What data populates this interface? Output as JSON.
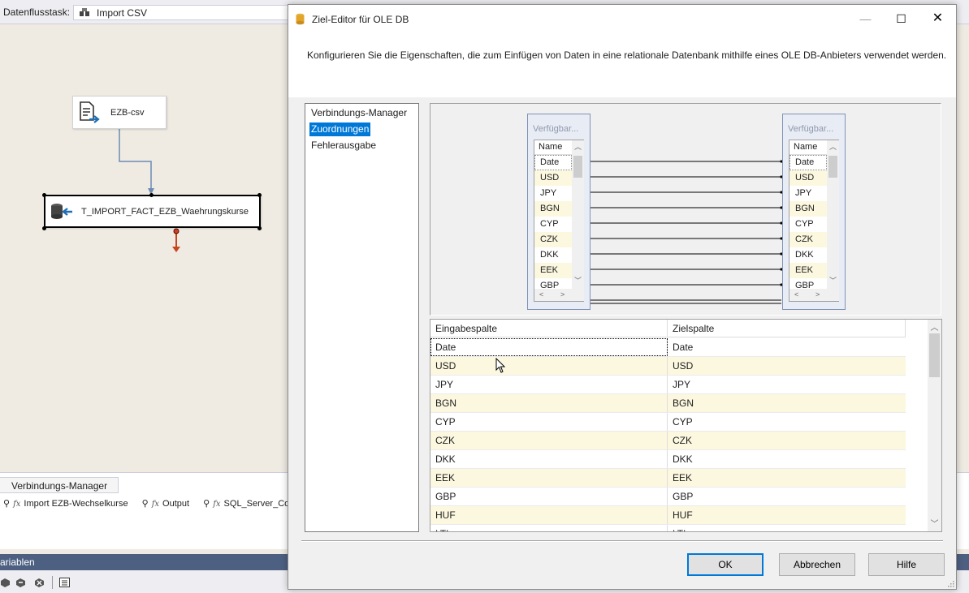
{
  "designer": {
    "task_label": "Datenflusstask:",
    "task_value": "Import CSV",
    "source_component": "EZB-csv",
    "destination_component": "T_IMPORT_FACT_EZB_Waehrungskurse",
    "connection_tab": "Verbindungs-Manager",
    "connections": [
      "Import EZB-Wechselkurse",
      "Output",
      "SQL_Server_Con"
    ],
    "fx_symbol": "fx",
    "variables_tab": "ariablen"
  },
  "dialog": {
    "title": "Ziel-Editor für OLE DB",
    "description": "Konfigurieren Sie die Eigenschaften, die zum Einfügen von Daten in eine relationale Datenbank mithilfe eines OLE DB-Anbieters verwendet werden.",
    "nav": [
      {
        "label": "Verbindungs-Manager",
        "selected": false
      },
      {
        "label": "Zuordnungen",
        "selected": true
      },
      {
        "label": "Fehlerausgabe",
        "selected": false
      }
    ],
    "input_box": {
      "header": "Verfügbar...",
      "column_header": "Name",
      "columns": [
        "Date",
        "USD",
        "JPY",
        "BGN",
        "CYP",
        "CZK",
        "DKK",
        "EEK",
        "GBP"
      ]
    },
    "dest_box": {
      "header": "Verfügbar...",
      "column_header": "Name",
      "columns": [
        "Date",
        "USD",
        "JPY",
        "BGN",
        "CYP",
        "CZK",
        "DKK",
        "EEK",
        "GBP"
      ]
    },
    "grid": {
      "headers": [
        "Eingabespalte",
        "Zielspalte"
      ],
      "rows": [
        [
          "Date",
          "Date"
        ],
        [
          "USD",
          "USD"
        ],
        [
          "JPY",
          "JPY"
        ],
        [
          "BGN",
          "BGN"
        ],
        [
          "CYP",
          "CYP"
        ],
        [
          "CZK",
          "CZK"
        ],
        [
          "DKK",
          "DKK"
        ],
        [
          "EEK",
          "EEK"
        ],
        [
          "GBP",
          "GBP"
        ],
        [
          "HUF",
          "HUF"
        ],
        [
          "LTL",
          "LTL"
        ]
      ]
    },
    "buttons": {
      "ok": "OK",
      "cancel": "Abbrechen",
      "help": "Hilfe"
    }
  },
  "colors": {
    "selection": "#0078d7",
    "alt_row": "#fcf8e0",
    "canvas": "#efebe3",
    "path_arrow": "#6b8bb4",
    "error_arrow": "#c8461e"
  }
}
